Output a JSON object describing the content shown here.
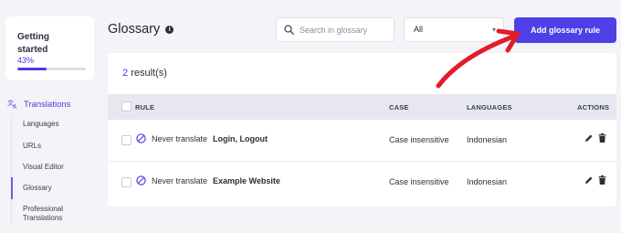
{
  "sidebar": {
    "progress": {
      "title": "Getting started",
      "percent_text": "43%",
      "fraction": 0.43
    },
    "section_label": "Translations",
    "section_icon": "translate-icon",
    "items": [
      {
        "label": "Languages"
      },
      {
        "label": "URLs"
      },
      {
        "label": "Visual Editor"
      },
      {
        "label": "Glossary",
        "active": true
      },
      {
        "label": "Professional Translations"
      }
    ]
  },
  "header": {
    "title": "Glossary",
    "info_icon": "info-icon",
    "search_placeholder": "Search in glossary",
    "filter_value": "All",
    "add_button": "Add glossary rule"
  },
  "results": {
    "count": "2",
    "label": " result(s)"
  },
  "table": {
    "columns": [
      "RULE",
      "CASE",
      "LANGUAGES",
      "ACTIONS"
    ],
    "rows": [
      {
        "prefix": "Never translate",
        "term": "Login, Logout",
        "case": "Case insensitive",
        "languages": "Indonesian"
      },
      {
        "prefix": "Never translate",
        "term": "Example Website",
        "case": "Case insensitive",
        "languages": "Indonesian"
      }
    ]
  },
  "colors": {
    "accent": "#4f3fe6",
    "annotation": "#e11d2a"
  }
}
